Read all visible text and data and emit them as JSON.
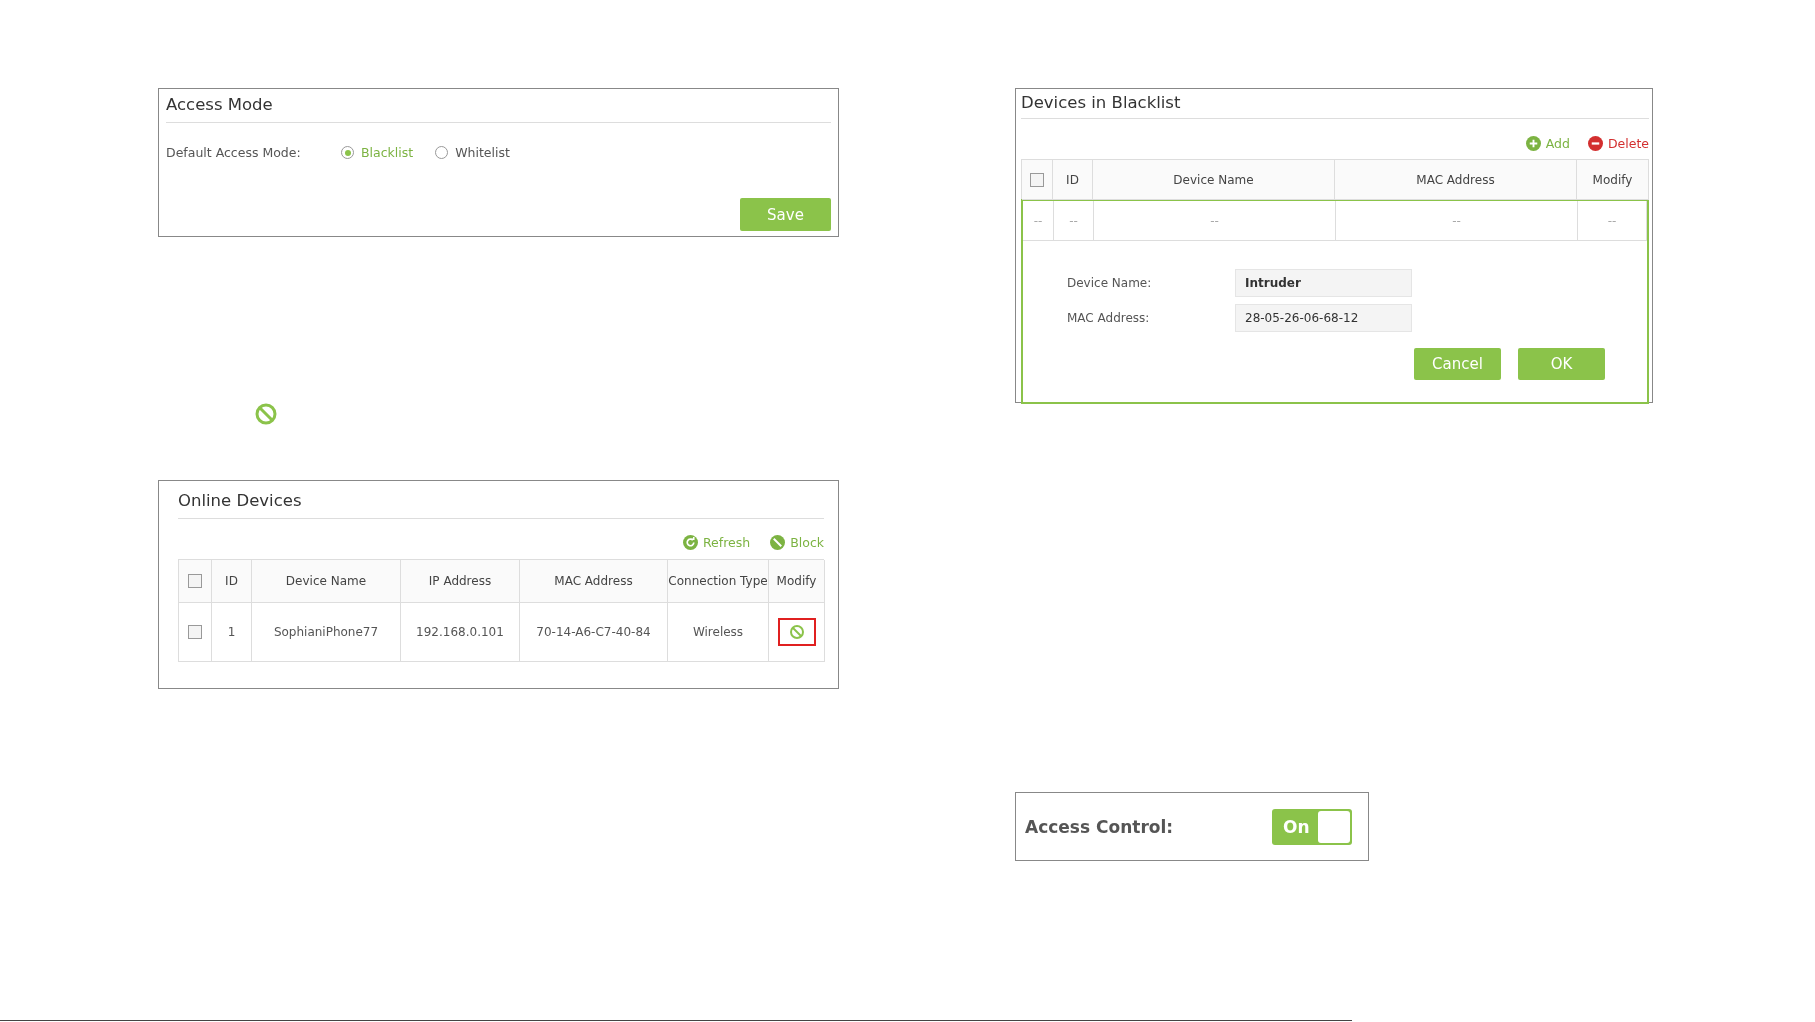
{
  "access_mode": {
    "title": "Access Mode",
    "label": "Default Access Mode:",
    "options": [
      {
        "label": "Blacklist",
        "selected": true
      },
      {
        "label": "Whitelist",
        "selected": false
      }
    ],
    "save_button": "Save"
  },
  "online_devices": {
    "title": "Online Devices",
    "actions": [
      {
        "kind": "refresh",
        "label": "Refresh"
      },
      {
        "kind": "block",
        "label": "Block"
      }
    ],
    "header_checked": false,
    "columns": [
      "ID",
      "Device Name",
      "IP Address",
      "MAC Address",
      "Connection Type",
      "Modify"
    ],
    "rows": [
      {
        "checked": false,
        "id": "1",
        "device_name": "SophianiPhone77",
        "ip_address": "192.168.0.101",
        "mac_address": "70-14-A6-C7-40-84",
        "connection_type": "Wireless",
        "highlighted": true
      }
    ]
  },
  "blacklist": {
    "title": "Devices in Blacklist",
    "actions": [
      {
        "kind": "add",
        "label": "Add"
      },
      {
        "kind": "delete",
        "label": "Delete"
      }
    ],
    "header_checked": false,
    "columns": [
      "ID",
      "Device Name",
      "MAC Address",
      "Modify"
    ],
    "rows": [
      {
        "checkbox": "--",
        "id": "--",
        "device_name": "--",
        "mac_address": "--",
        "modify": "--"
      }
    ],
    "form": {
      "fields": [
        {
          "label": "Device Name:",
          "value": "Intruder",
          "bold": true
        },
        {
          "label": "MAC Address:",
          "value": "28-05-26-06-68-12",
          "bold": false
        }
      ],
      "buttons": [
        "Cancel",
        "OK"
      ]
    }
  },
  "access_control": {
    "label": "Access Control:",
    "on": true,
    "switch_label": "On"
  }
}
